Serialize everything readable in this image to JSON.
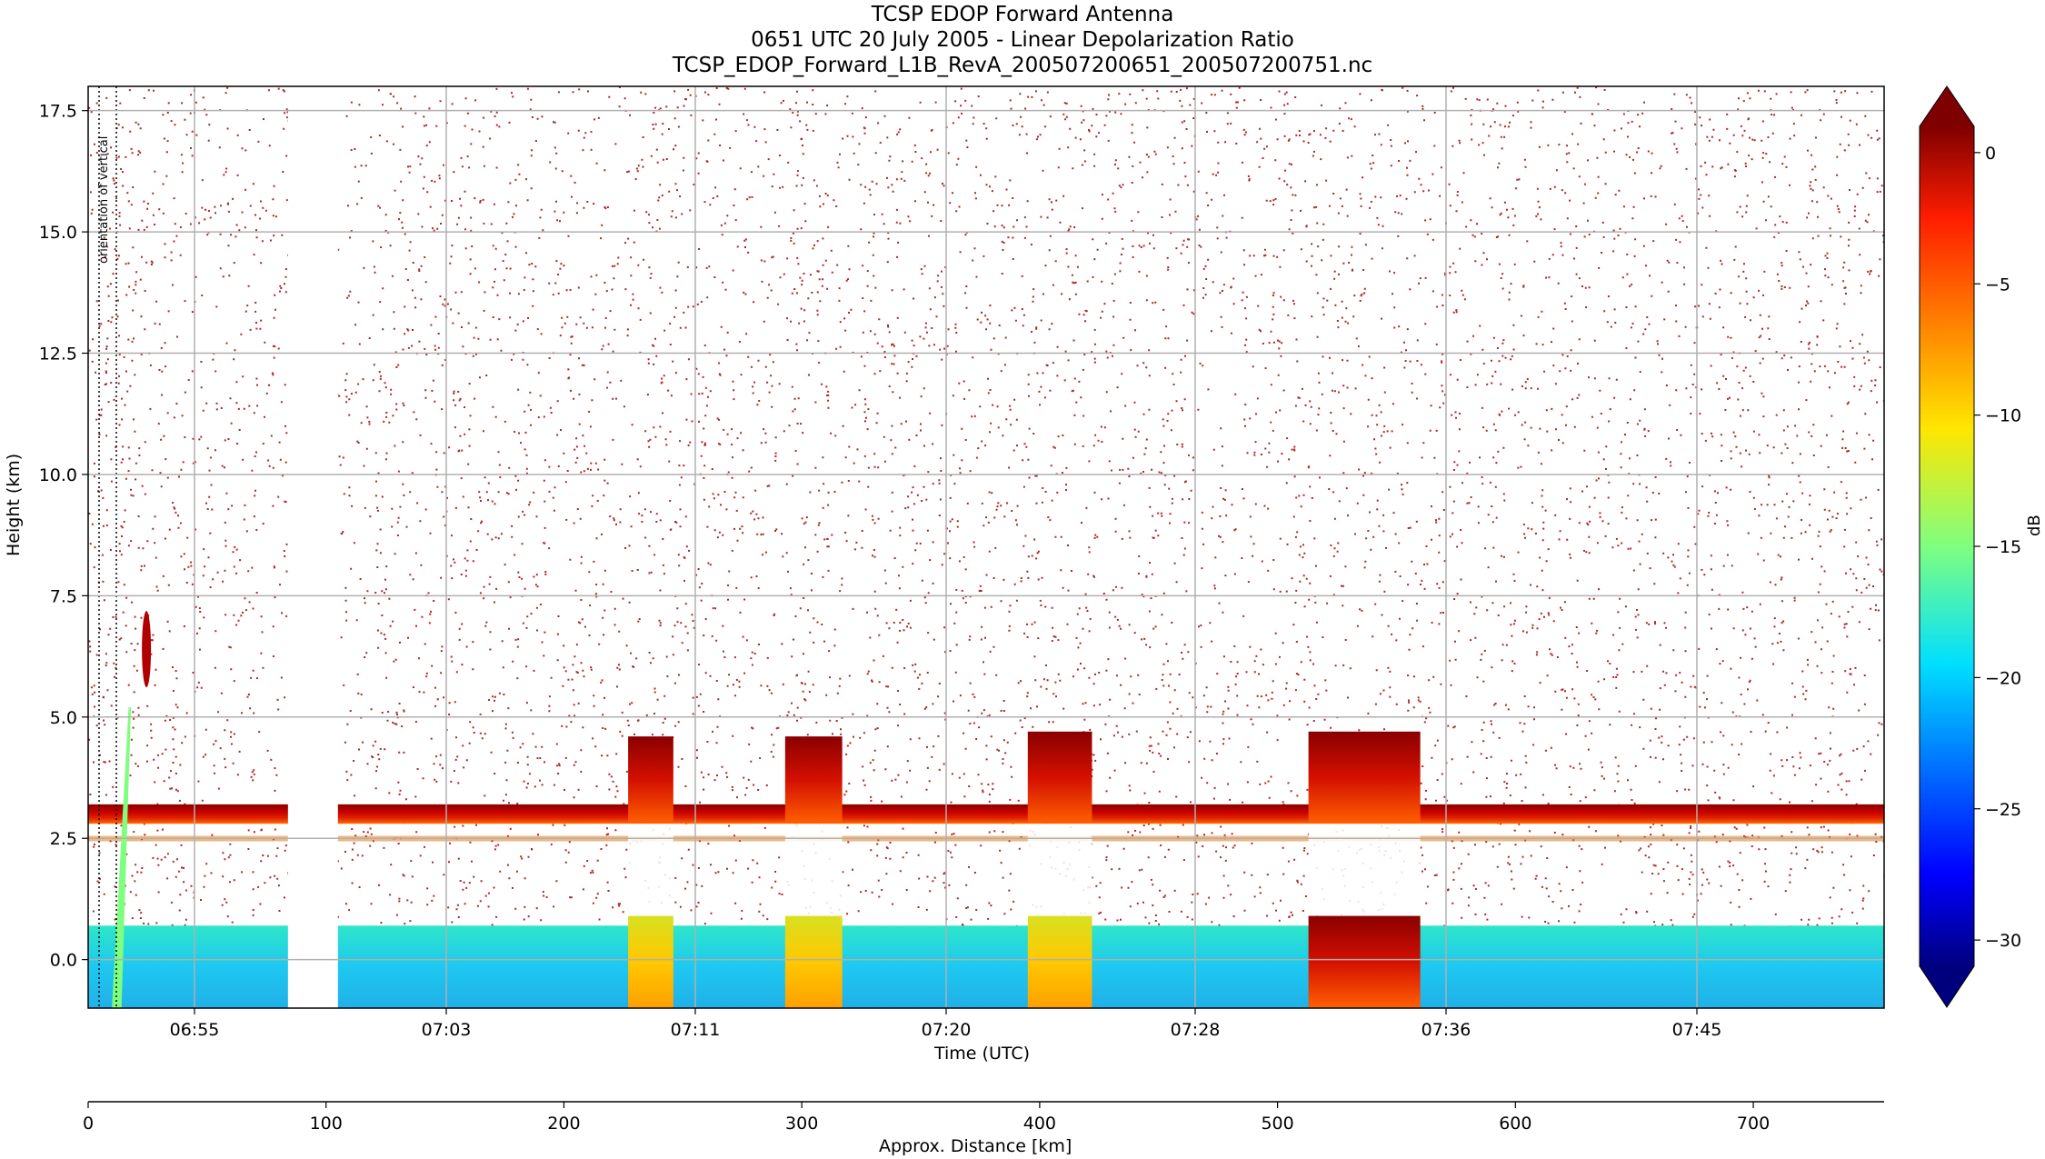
{
  "chart_data": {
    "type": "heatmap",
    "title_lines": [
      "TCSP EDOP Forward Antenna",
      "0651 UTC 20 July 2005 - Linear Depolarization Ratio",
      "TCSP_EDOP_Forward_L1B_RevA_200507200651_200507200751.nc"
    ],
    "xlabel": "Time (UTC)",
    "ylabel": "Height (km)",
    "x2label": "Approx. Distance [km]",
    "colorbar_label": "dB",
    "annotation": "orientation of vertical",
    "time_ticks": [
      "06:55",
      "07:03",
      "07:11",
      "07:20",
      "07:28",
      "07:36",
      "07:45"
    ],
    "y_ticks": [
      "17.5",
      "15.0",
      "12.5",
      "10.0",
      "7.5",
      "5.0",
      "2.5",
      "0.0"
    ],
    "y_tick_values": [
      17.5,
      15.0,
      12.5,
      10.0,
      7.5,
      5.0,
      2.5,
      0.0
    ],
    "ylim": [
      -1.0,
      18.0
    ],
    "distance_ticks": [
      "0",
      "100",
      "200",
      "300",
      "400",
      "500",
      "600",
      "700"
    ],
    "distance_tick_values": [
      0,
      100,
      200,
      300,
      400,
      500,
      600,
      700
    ],
    "distance_lim": [
      0,
      755
    ],
    "colorbar_ticks": [
      "0",
      "−5",
      "−10",
      "−15",
      "−20",
      "−25",
      "−30"
    ],
    "colorbar_tick_values": [
      0,
      -5,
      -10,
      -15,
      -20,
      -25,
      -30
    ],
    "colorbar_lim": [
      -31,
      1
    ],
    "colormap": "jet",
    "grid": true,
    "data_gap_km": [
      84,
      105
    ],
    "features": {
      "melting_layer_km": [
        2.8,
        3.2
      ],
      "surface_band_km": [
        -1.0,
        0.7
      ],
      "surface_band_dB": -20,
      "melting_layer_dB": -2,
      "elevated_segments": [
        {
          "dist_km": [
            227,
            246
          ],
          "top_km": 4.6,
          "surface_dB": -10
        },
        {
          "dist_km": [
            293,
            317
          ],
          "top_km": 4.6,
          "surface_dB": -8
        },
        {
          "dist_km": [
            395,
            422
          ],
          "top_km": 4.7,
          "surface_dB": -10
        },
        {
          "dist_km": [
            513,
            560
          ],
          "top_km": 4.7,
          "surface_dB": -3
        }
      ]
    }
  }
}
